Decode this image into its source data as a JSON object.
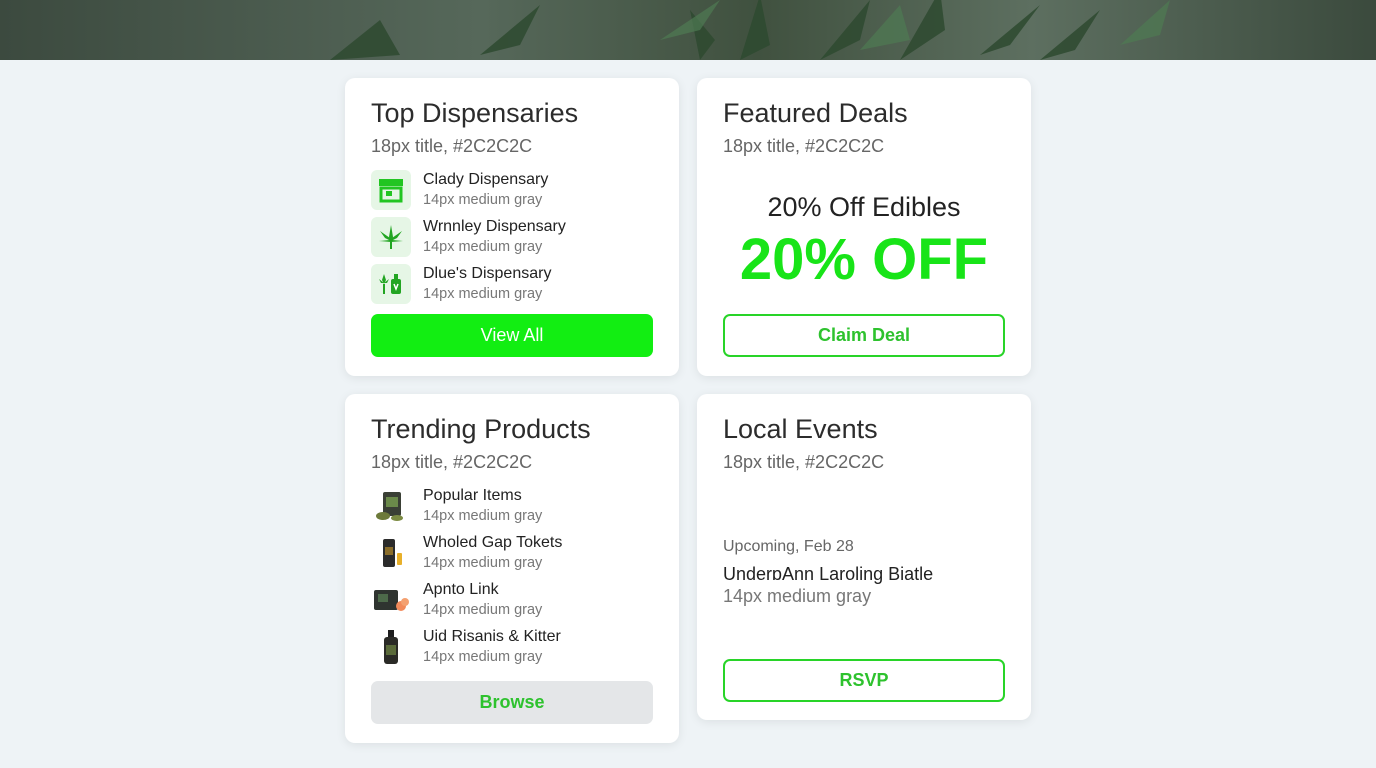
{
  "colors": {
    "accent": "#12ee12",
    "title": "#2C2C2C",
    "muted": "#777777"
  },
  "dispensaries": {
    "title": "Top Dispensaries",
    "subtitle": "18px title, #2C2C2C",
    "items": [
      {
        "name": "Clady Dispensary",
        "meta": "14px medium gray",
        "icon": "storefront-icon"
      },
      {
        "name": "Wrnnley Dispensary",
        "meta": "14px medium gray",
        "icon": "cannabis-leaf-icon"
      },
      {
        "name": "Dlue's Dispensary",
        "meta": "14px medium gray",
        "icon": "bottle-leaf-icon"
      }
    ],
    "button": "View All"
  },
  "deals": {
    "title": "Featured Deals",
    "subtitle": "18px title, #2C2C2C",
    "deal_title": "20% Off Edibles",
    "deal_big": "20% OFF",
    "button": "Claim Deal"
  },
  "products": {
    "title": "Trending Products",
    "subtitle": "18px title, #2C2C2C",
    "items": [
      {
        "name": "Popular Items",
        "meta": "14px medium gray",
        "icon": "product-bag-icon"
      },
      {
        "name": "Wholed Gap Tokets",
        "meta": "14px medium gray",
        "icon": "product-jar-icon"
      },
      {
        "name": "Apnto Link",
        "meta": "14px medium gray",
        "icon": "product-box-icon"
      },
      {
        "name": "Uid Risanis & Kitter",
        "meta": "14px medium gray",
        "icon": "tincture-bottle-icon"
      }
    ],
    "button": "Browse"
  },
  "events": {
    "title": "Local Events",
    "subtitle": "18px title, #2C2C2C",
    "date": "Upcoming, Feb 28",
    "name": "UnderɒAnn Laroling Biatle",
    "meta": "14px medium gray",
    "button": "RSVP"
  }
}
